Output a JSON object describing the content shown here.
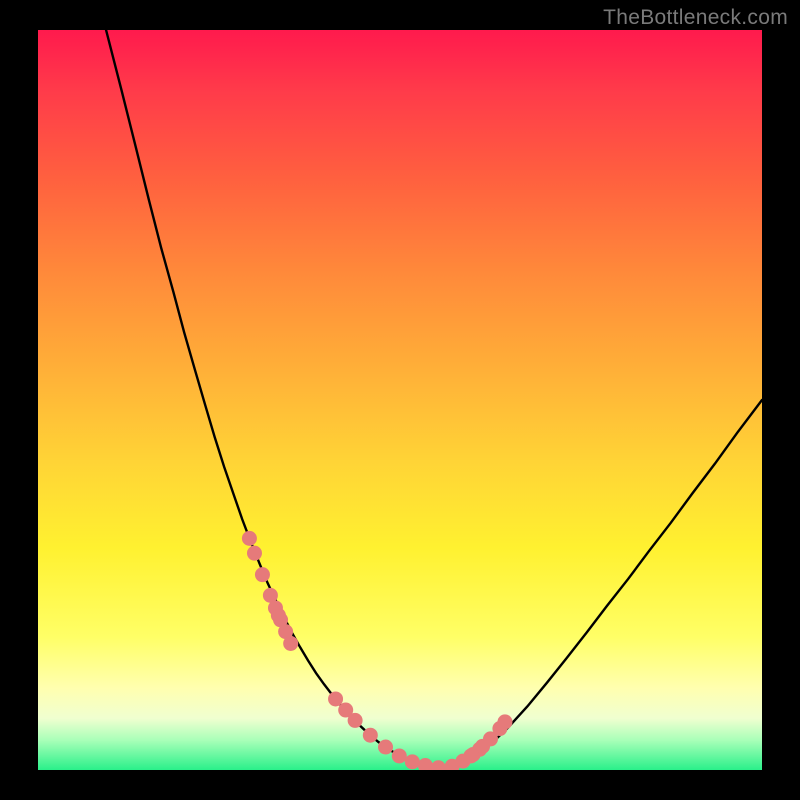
{
  "watermark": "TheBottleneck.com",
  "colors": {
    "background": "#000000",
    "curve_stroke": "#000000",
    "marker_fill": "#e67a7a",
    "marker_stroke": "#bb4a4a",
    "gradient": [
      "#ff1a4d",
      "#ff3a4a",
      "#ff603f",
      "#ff8a3a",
      "#ffb038",
      "#ffd336",
      "#fff130",
      "#ffff66",
      "#ffffb0",
      "#f0ffd0",
      "#a8ffb8",
      "#2af08a"
    ]
  },
  "chart_data": {
    "type": "line",
    "title": "",
    "xlabel": "",
    "ylabel": "",
    "xlim": [
      0,
      100
    ],
    "ylim": [
      0,
      100
    ],
    "x": [
      9.4,
      11.5,
      13.5,
      15.3,
      17.0,
      18.7,
      20.2,
      21.7,
      23.1,
      24.4,
      25.7,
      27.0,
      28.2,
      29.4,
      30.6,
      31.7,
      32.9,
      34.0,
      35.1,
      36.2,
      37.3,
      38.4,
      39.5,
      40.6,
      41.7,
      42.7,
      43.8,
      44.9,
      45.9,
      47.0,
      48.0,
      49.9,
      51.7,
      53.5,
      55.3,
      57.2,
      59.7,
      62.3,
      64.9,
      67.6,
      70.3,
      73.0,
      75.8,
      78.6,
      81.5,
      84.4,
      87.4,
      90.4,
      93.5,
      96.6,
      100.0
    ],
    "values": [
      100.0,
      92.0,
      84.2,
      77.1,
      70.6,
      64.6,
      59.1,
      54.0,
      49.3,
      45.0,
      41.0,
      37.3,
      33.9,
      30.8,
      27.9,
      25.3,
      22.8,
      20.6,
      18.5,
      16.6,
      14.8,
      13.1,
      11.6,
      10.2,
      8.9,
      7.7,
      6.6,
      5.6,
      4.7,
      3.8,
      3.1,
      1.9,
      1.1,
      0.6,
      0.3,
      0.5,
      1.5,
      3.3,
      5.7,
      8.6,
      11.8,
      15.1,
      18.6,
      22.2,
      25.8,
      29.6,
      33.4,
      37.4,
      41.4,
      45.6,
      50.0
    ],
    "markers": {
      "x": [
        29.2,
        29.9,
        31.0,
        32.1,
        32.8,
        33.2,
        33.5,
        34.2,
        34.9,
        41.1,
        42.5,
        43.8,
        45.9,
        48.0,
        49.9,
        51.7,
        53.5,
        55.3,
        57.2,
        58.7,
        59.8,
        60.1,
        61.0,
        61.4,
        62.5,
        63.8,
        64.5
      ],
      "values": [
        31.3,
        29.3,
        26.4,
        23.6,
        21.9,
        20.9,
        20.3,
        18.7,
        17.1,
        9.6,
        8.1,
        6.7,
        4.7,
        3.1,
        1.9,
        1.1,
        0.6,
        0.3,
        0.5,
        1.2,
        1.9,
        2.1,
        2.8,
        3.2,
        4.2,
        5.6,
        6.5
      ]
    }
  }
}
